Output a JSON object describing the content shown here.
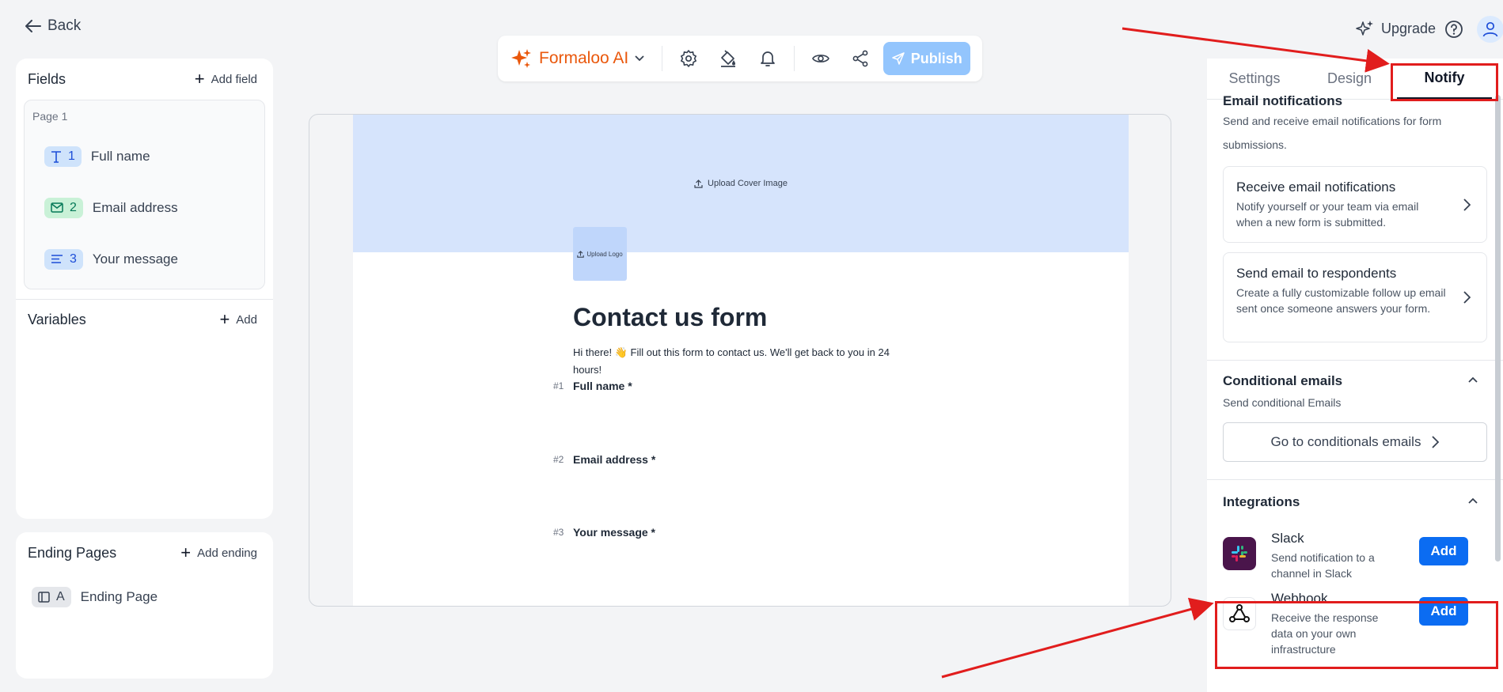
{
  "header": {
    "back_label": "Back",
    "upgrade_label": "Upgrade"
  },
  "toolbar": {
    "ai_label": "Formaloo AI",
    "publish_label": "Publish",
    "icons": [
      "settings-icon",
      "paint-bucket-icon",
      "bell-icon",
      "eye-icon",
      "share-icon"
    ]
  },
  "fields_panel": {
    "title": "Fields",
    "add_label": "Add field",
    "page_label": "Page 1",
    "items": [
      {
        "num": "1",
        "label": "Full name",
        "icon": "text-type-icon"
      },
      {
        "num": "2",
        "label": "Email address",
        "icon": "mail-icon"
      },
      {
        "num": "3",
        "label": "Your message",
        "icon": "paragraph-icon"
      }
    ]
  },
  "variables_panel": {
    "title": "Variables",
    "add_label": "Add"
  },
  "ending_panel": {
    "title": "Ending Pages",
    "add_label": "Add ending",
    "items": [
      {
        "badge": "A",
        "label": "Ending Page"
      }
    ]
  },
  "form": {
    "cover_label": "Upload Cover Image",
    "logo_label": "Upload Logo",
    "title": "Contact us form",
    "description": "Hi there! 👋 Fill out this form to contact us. We'll get back to you in 24 hours!",
    "questions": [
      {
        "num": "#1",
        "label": "Full name *"
      },
      {
        "num": "#2",
        "label": "Email address *"
      },
      {
        "num": "#3",
        "label": "Your message *"
      }
    ]
  },
  "right_panel": {
    "tabs": [
      "Settings",
      "Design",
      "Notify"
    ],
    "active_tab": "Notify",
    "email_section": {
      "title": "Email notifications",
      "subtitle": "Send and receive email notifications for form submissions.",
      "cards": [
        {
          "title": "Receive email notifications",
          "desc": "Notify yourself or your team via email when a new form is submitted."
        },
        {
          "title": "Send email to respondents",
          "desc": "Create a fully customizable follow up email sent once someone answers your form."
        }
      ]
    },
    "conditional_section": {
      "title": "Conditional emails",
      "subtitle": "Send conditional Emails",
      "button_label": "Go to conditionals emails"
    },
    "integrations_section": {
      "title": "Integrations",
      "items": [
        {
          "name": "Slack",
          "desc": "Send notification to a channel in Slack",
          "button": "Add",
          "icon": "slack-icon"
        },
        {
          "name": "Webhook",
          "desc": "Receive the response data on your own infrastructure",
          "button": "Add",
          "icon": "webhook-icon"
        }
      ]
    }
  },
  "colors": {
    "accent_orange": "#ea580c",
    "publish_disabled": "#93c5fd",
    "add_button_blue": "#0b6cf2",
    "annotation_red": "#e11d1d",
    "cover_blue": "#d6e4fc"
  }
}
